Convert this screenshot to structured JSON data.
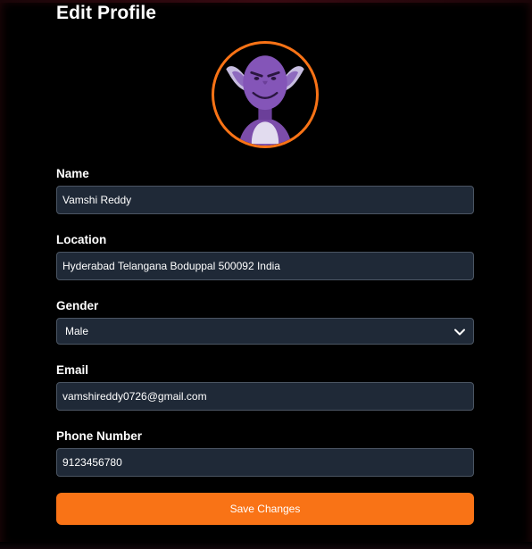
{
  "page": {
    "title": "Edit Profile"
  },
  "avatar": {
    "icon": "goblin-avatar-icon",
    "ring_color": "#f97316"
  },
  "form": {
    "name": {
      "label": "Name",
      "value": "Vamshi Reddy"
    },
    "location": {
      "label": "Location",
      "value": "Hyderabad Telangana Boduppal 500092 India"
    },
    "gender": {
      "label": "Gender",
      "value": "Male"
    },
    "email": {
      "label": "Email",
      "value": "vamshireddy0726@gmail.com"
    },
    "phone": {
      "label": "Phone Number",
      "value": "9123456780"
    }
  },
  "actions": {
    "save_label": "Save Changes"
  },
  "colors": {
    "background": "#000000",
    "input_bg": "#1f2937",
    "input_border": "#4b5563",
    "accent": "#f97316"
  }
}
